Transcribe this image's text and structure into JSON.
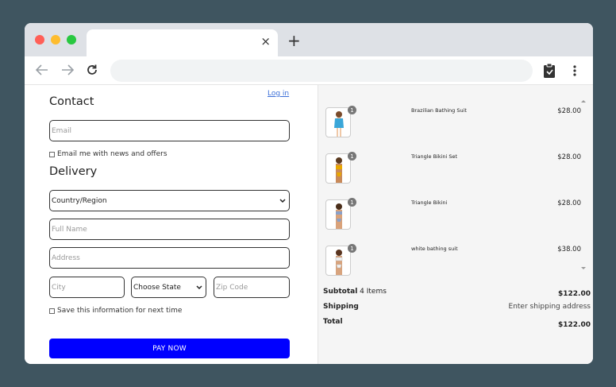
{
  "browser": {
    "tab_close": "×",
    "new_tab": "+",
    "menu": "⋮"
  },
  "contact": {
    "heading": "Contact",
    "login_link": "Log in",
    "email_placeholder": "Email",
    "newsletter_label": "Email me with news and offers"
  },
  "delivery": {
    "heading": "Delivery",
    "country_selected": "Country/Region",
    "full_name_placeholder": "Full Name",
    "address_placeholder": "Address",
    "city_placeholder": "City",
    "state_selected": "Choose State",
    "zip_placeholder": "Zip Code",
    "save_info_label": "Save this information for next time"
  },
  "pay_button": "PAY NOW",
  "cart": {
    "items": [
      {
        "name": "Brazilian Bathing Suit",
        "price": "$28.00",
        "qty": "1"
      },
      {
        "name": "Triangle Bikini Set",
        "price": "$28.00",
        "qty": "1"
      },
      {
        "name": "Triangle Bikini",
        "price": "$28.00",
        "qty": "1"
      },
      {
        "name": "white bathing suit",
        "price": "$38.00",
        "qty": "1"
      }
    ],
    "subtotal_label": "Subtotal",
    "subtotal_count": "4 Items",
    "subtotal_value": "$122.00",
    "shipping_label": "Shipping",
    "shipping_value": "Enter shipping address",
    "total_label": "Total",
    "total_value": "$122.00"
  },
  "colors": {
    "pay_button": "#0000ff",
    "link": "#3b6fd8",
    "backdrop": "#3f5560"
  }
}
